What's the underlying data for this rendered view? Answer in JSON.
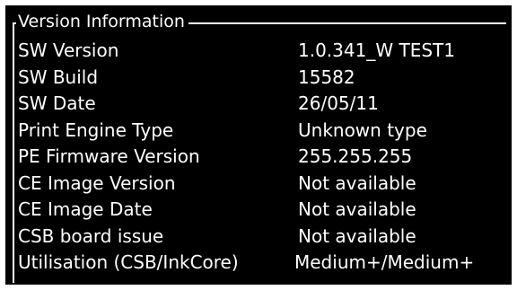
{
  "panel": {
    "title": "Version Information"
  },
  "rows": [
    {
      "label": "SW Version",
      "value": "1.0.341_W TEST1"
    },
    {
      "label": "SW Build",
      "value": "15582"
    },
    {
      "label": "SW Date",
      "value": "26/05/11"
    },
    {
      "label": "Print Engine Type",
      "value": "Unknown type"
    },
    {
      "label": "PE Firmware Version",
      "value": "255.255.255"
    },
    {
      "label": "CE Image Version",
      "value": "Not available"
    },
    {
      "label": "CE Image Date",
      "value": "Not available"
    },
    {
      "label": "CSB board issue",
      "value": "Not available"
    },
    {
      "label": "Utilisation (CSB/InkCore)",
      "value": "Medium+/Medium+"
    }
  ],
  "colors": {
    "background": "#000000",
    "text": "#ffffff"
  }
}
